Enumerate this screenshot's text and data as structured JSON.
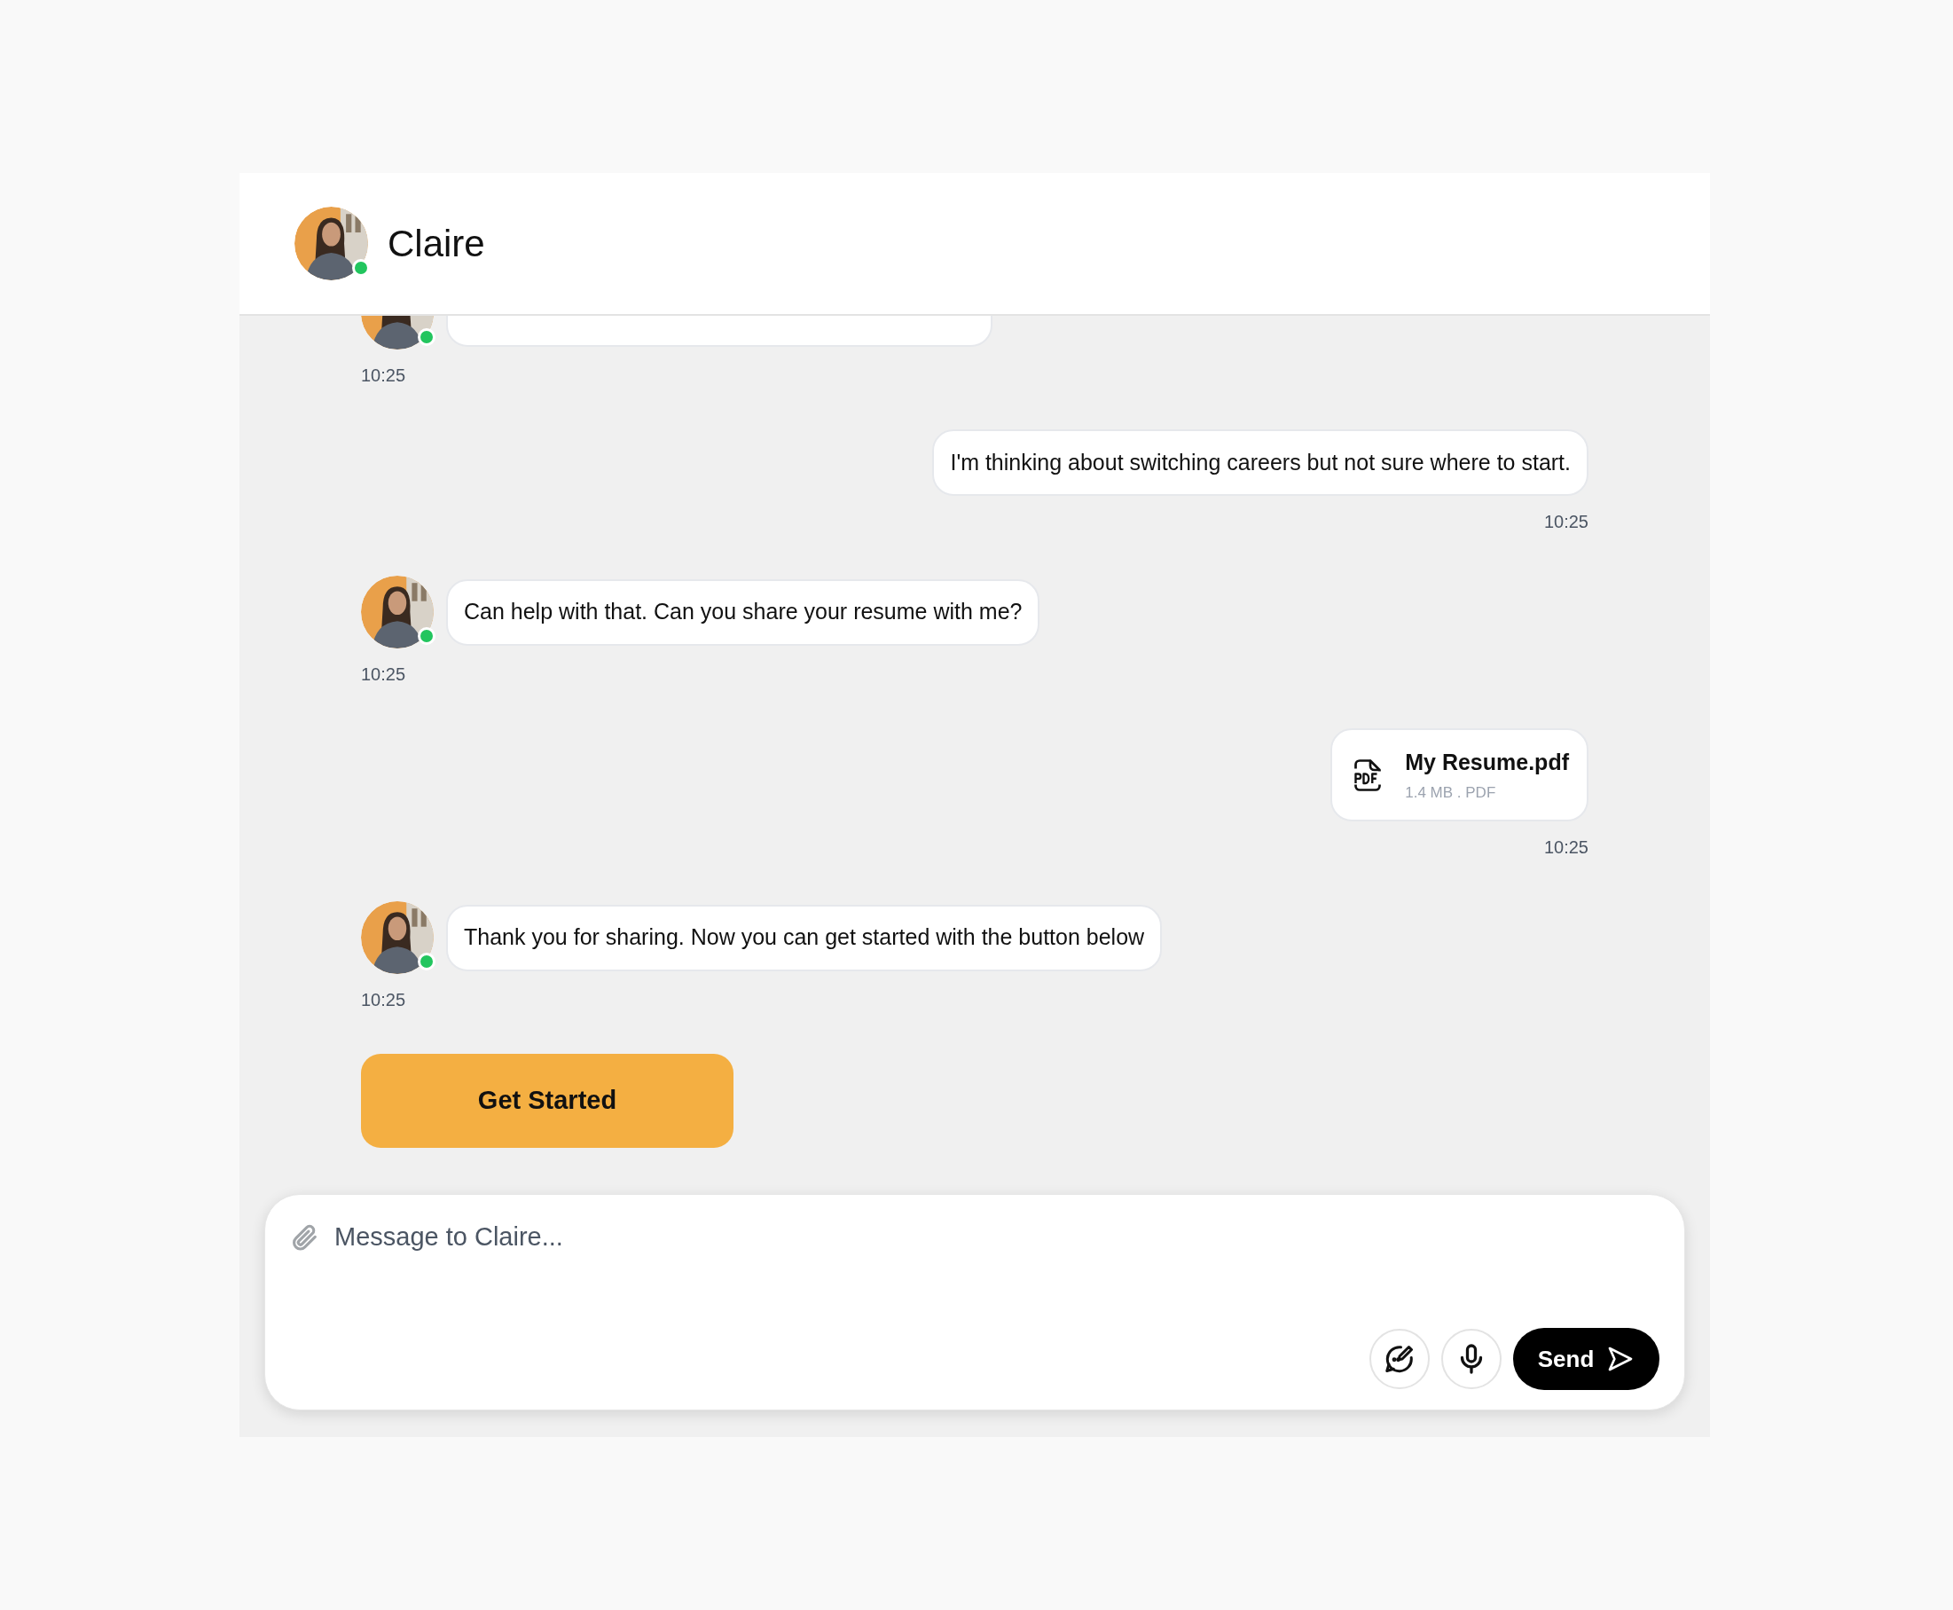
{
  "header": {
    "name": "Claire",
    "online": true
  },
  "messages": [
    {
      "outgoing": false,
      "kind": "text",
      "time": "10:25",
      "online": true
    },
    {
      "outgoing": true,
      "kind": "text",
      "text": "I'm thinking about switching careers but not sure where to start.",
      "time": "10:25"
    },
    {
      "outgoing": false,
      "kind": "text",
      "text": "Can help with that. Can you share your resume with me?",
      "time": "10:25",
      "online": true
    },
    {
      "outgoing": true,
      "kind": "file",
      "file_name": "My Resume.pdf",
      "file_meta": "1.4 MB . PDF",
      "time": "10:25"
    },
    {
      "outgoing": false,
      "kind": "text",
      "text": "Thank you for sharing. Now you can get started with the button below",
      "time": "10:25",
      "online": true
    }
  ],
  "action_button": "Get Started",
  "composer": {
    "placeholder": "Message to Claire...",
    "send_label": "Send"
  }
}
